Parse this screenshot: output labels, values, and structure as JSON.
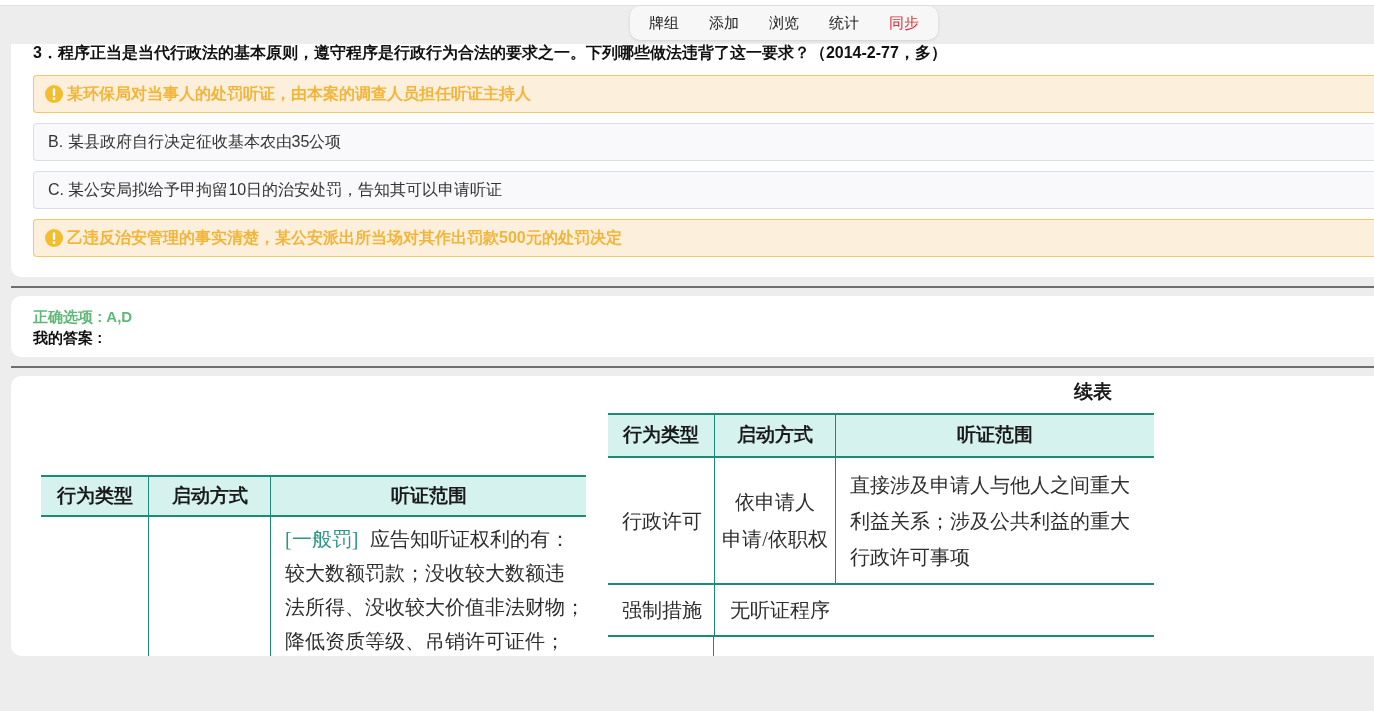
{
  "toolbar": {
    "items": [
      {
        "label": "牌组",
        "kind": "plain"
      },
      {
        "label": "添加",
        "kind": "plain"
      },
      {
        "label": "浏览",
        "kind": "plain"
      },
      {
        "label": "统计",
        "kind": "plain"
      },
      {
        "label": "同步",
        "kind": "alert"
      }
    ]
  },
  "question": {
    "text": "3．程序正当是当代行政法的基本原则，遵守程序是行政行为合法的要求之一。下列哪些做法违背了这一要求？（2014-2-77，多）",
    "options": [
      {
        "text": "某环保局对当事人的处罚听证，由本案的调查人员担任听证主持人",
        "correct": true
      },
      {
        "text": "B. 某县政府自行决定征收基本农由35公项",
        "correct": false
      },
      {
        "text": "C. 某公安局拟给予甲拘留10日的治安处罚，告知其可以申请听证",
        "correct": false
      },
      {
        "text": "乙违反治安管理的事实清楚，某公安派出所当场对其作出罚款500元的处罚决定",
        "correct": true
      }
    ]
  },
  "result": {
    "correct_answer": "正确选项 : A,D",
    "my_answer": "我的答案 :"
  },
  "explanation": {
    "left_table": {
      "columns": [
        "行为类型",
        "启动方式",
        "听证范围"
      ],
      "rows": [
        {
          "kind": "full",
          "scope_tag": "[一般罚]",
          "scope_lines": [
            "应告知听证权利的有：",
            "较大数额罚款；没收较大数额违",
            "法所得、没收较大价值非法财物；",
            "降低资质等级、吊销许可证件；"
          ]
        }
      ]
    },
    "right_table": {
      "caption": "续表",
      "columns": [
        "行为类型",
        "启动方式",
        "听证范围"
      ],
      "rows": [
        {
          "kind": "full",
          "type": "行政许可",
          "start_lines": [
            "依申请人",
            "申请/依职权"
          ],
          "scope_lines": [
            "直接涉及申请人与他人之间重大",
            "利益关系；涉及公共利益的重大",
            "行政许可事项"
          ]
        },
        {
          "kind": "merged",
          "type": "强制措施",
          "note": "无听证程序"
        }
      ]
    }
  }
}
